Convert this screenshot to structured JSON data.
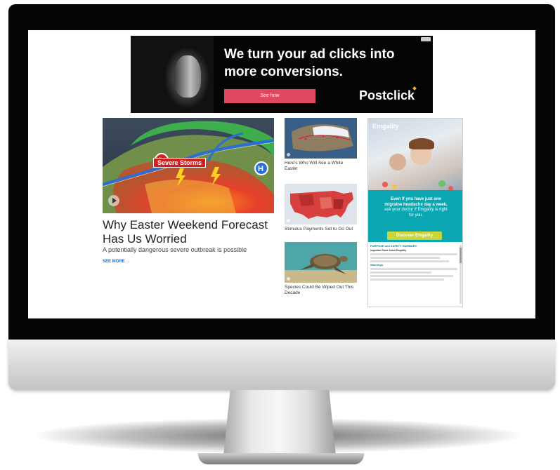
{
  "top_ad": {
    "headline": "We turn your ad clicks into more conversions.",
    "cta": "See how",
    "brand": "Postclick"
  },
  "main_story": {
    "image_label": "Severe Storms",
    "title": "Why Easter Weekend Forecast Has Us Worried",
    "subtitle": "A potentially dangerous severe outbreak is possible",
    "see_more": "SEE MORE →"
  },
  "cards": [
    {
      "caption": "Here's Who Will See a White Easter"
    },
    {
      "caption": "Stimulus Payments Set to Go Out"
    },
    {
      "caption": "Species Could Be Wiped Out This Decade"
    }
  ],
  "side_ad": {
    "brand": "Emgality",
    "copy_bold": "Even if you have just one migraine headache day a week,",
    "copy_light": "ask your doctor if Emgality is right for you.",
    "cta": "Discover Emgality",
    "isi_heading": "PURPOSE and SAFETY SUMMARY",
    "isi_lead": "Important Facts About Emgality",
    "warnings_heading": "Warnings"
  },
  "colors": {
    "ad_cta": "#e1475e",
    "link": "#1e6fd1",
    "side_teal": "#0aa7b3",
    "side_button": "#c6d63b",
    "storm_red": "#d41f1f"
  }
}
